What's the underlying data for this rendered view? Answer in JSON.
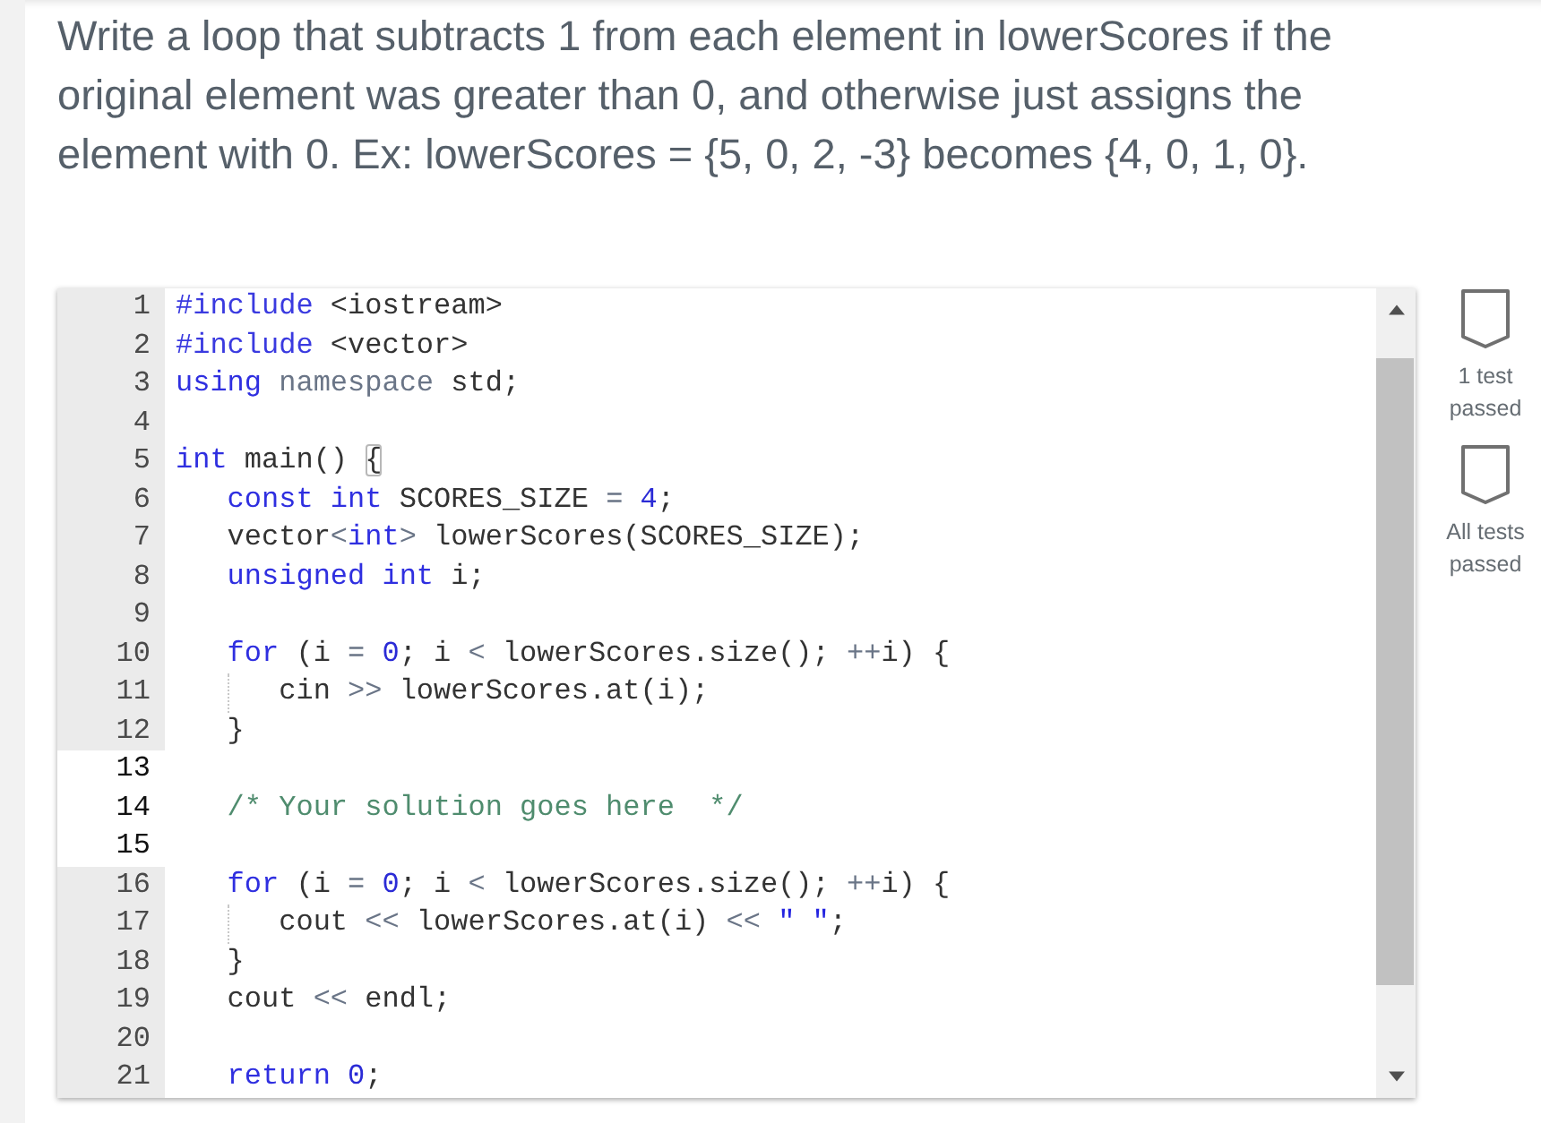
{
  "prompt": "Write a loop that subtracts 1 from each element in lowerScores if the original element was greater than 0, and otherwise just assigns the element with 0. Ex: lowerScores = {5, 0, 2, -3} becomes {4, 0, 1, 0}.",
  "editor": {
    "lines": [
      {
        "number": "1",
        "editable": false,
        "tokens": [
          {
            "kind": "preprocessor",
            "text": "#include"
          },
          {
            "kind": "plain",
            "text": " <iostream>"
          }
        ]
      },
      {
        "number": "2",
        "editable": false,
        "tokens": [
          {
            "kind": "preprocessor",
            "text": "#include"
          },
          {
            "kind": "plain",
            "text": " <vector>"
          }
        ]
      },
      {
        "number": "3",
        "editable": false,
        "tokens": [
          {
            "kind": "keyword",
            "text": "using "
          },
          {
            "kind": "operator",
            "text": "namespace"
          },
          {
            "kind": "plain",
            "text": " std;"
          }
        ]
      },
      {
        "number": "4",
        "editable": false
      },
      {
        "number": "5",
        "editable": false,
        "tokens": [
          {
            "kind": "keyword",
            "text": "int"
          },
          {
            "kind": "plain",
            "text": " main() "
          },
          {
            "kind": "matched-bracket",
            "text": "{"
          }
        ]
      },
      {
        "number": "6",
        "editable": false,
        "tokens": [
          {
            "kind": "keyword",
            "text": "   const "
          },
          {
            "kind": "keyword",
            "text": "int"
          },
          {
            "kind": "plain",
            "text": " SCORES_SIZE "
          },
          {
            "kind": "operator",
            "text": "= "
          },
          {
            "kind": "number",
            "text": "4"
          },
          {
            "kind": "plain",
            "text": ";"
          }
        ]
      },
      {
        "number": "7",
        "editable": false,
        "tokens": [
          {
            "kind": "plain",
            "text": "   vector"
          },
          {
            "kind": "operator",
            "text": "<"
          },
          {
            "kind": "keyword",
            "text": "int"
          },
          {
            "kind": "operator",
            "text": ">"
          },
          {
            "kind": "plain",
            "text": " lowerScores(SCORES_SIZE);"
          }
        ]
      },
      {
        "number": "8",
        "editable": false,
        "tokens": [
          {
            "kind": "keyword",
            "text": "   unsigned "
          },
          {
            "kind": "keyword",
            "text": "int"
          },
          {
            "kind": "plain",
            "text": " i;"
          }
        ]
      },
      {
        "number": "9",
        "editable": false
      },
      {
        "number": "10",
        "editable": false,
        "tokens": [
          {
            "kind": "keyword",
            "text": "   for"
          },
          {
            "kind": "plain",
            "text": " (i "
          },
          {
            "kind": "operator",
            "text": "= "
          },
          {
            "kind": "number",
            "text": "0"
          },
          {
            "kind": "plain",
            "text": "; i "
          },
          {
            "kind": "operator",
            "text": "<"
          },
          {
            "kind": "plain",
            "text": " lowerScores.size(); "
          },
          {
            "kind": "operator",
            "text": "++"
          },
          {
            "kind": "plain",
            "text": "i) {"
          }
        ]
      },
      {
        "number": "11",
        "editable": false,
        "tokens": [
          {
            "kind": "plain",
            "text": "      cin "
          },
          {
            "kind": "operator",
            "text": ">>"
          },
          {
            "kind": "plain",
            "text": " lowerScores.at(i);"
          }
        ]
      },
      {
        "number": "12",
        "editable": false,
        "tokens": [
          {
            "kind": "plain",
            "text": "   }"
          }
        ]
      },
      {
        "number": "13",
        "editable": true
      },
      {
        "number": "14",
        "editable": true,
        "tokens": [
          {
            "kind": "comment",
            "text": "   /* Your solution goes here  */"
          }
        ]
      },
      {
        "number": "15",
        "editable": true
      },
      {
        "number": "16",
        "editable": false,
        "tokens": [
          {
            "kind": "keyword",
            "text": "   for"
          },
          {
            "kind": "plain",
            "text": " (i "
          },
          {
            "kind": "operator",
            "text": "= "
          },
          {
            "kind": "number",
            "text": "0"
          },
          {
            "kind": "plain",
            "text": "; i "
          },
          {
            "kind": "operator",
            "text": "<"
          },
          {
            "kind": "plain",
            "text": " lowerScores.size(); "
          },
          {
            "kind": "operator",
            "text": "++"
          },
          {
            "kind": "plain",
            "text": "i) {"
          }
        ]
      },
      {
        "number": "17",
        "editable": false,
        "tokens": [
          {
            "kind": "plain",
            "text": "      cout "
          },
          {
            "kind": "operator",
            "text": "<<"
          },
          {
            "kind": "plain",
            "text": " lowerScores.at(i) "
          },
          {
            "kind": "operator",
            "text": "<< "
          },
          {
            "kind": "string",
            "text": "\" \""
          },
          {
            "kind": "plain",
            "text": ";"
          }
        ]
      },
      {
        "number": "18",
        "editable": false,
        "tokens": [
          {
            "kind": "plain",
            "text": "   }"
          }
        ]
      },
      {
        "number": "19",
        "editable": false,
        "tokens": [
          {
            "kind": "plain",
            "text": "   cout "
          },
          {
            "kind": "operator",
            "text": "<<"
          },
          {
            "kind": "plain",
            "text": " endl;"
          }
        ]
      },
      {
        "number": "20",
        "editable": false
      },
      {
        "number": "21",
        "editable": false,
        "tokens": [
          {
            "kind": "keyword",
            "text": "   return "
          },
          {
            "kind": "number",
            "text": "0"
          },
          {
            "kind": "plain",
            "text": ";"
          }
        ]
      }
    ]
  },
  "tests": [
    {
      "label": "1 test passed",
      "passed": false
    },
    {
      "label": "All tests passed",
      "passed": false
    }
  ]
}
